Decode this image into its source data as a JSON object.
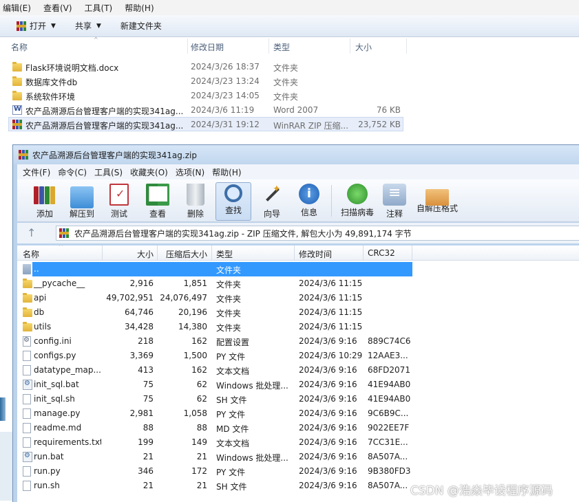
{
  "explorer": {
    "menu": [
      "编辑(E)",
      "查看(V)",
      "工具(T)",
      "帮助(H)"
    ],
    "toolbar": {
      "open_label": "打开",
      "share_label": "共享",
      "new_folder_label": "新建文件夹"
    },
    "columns": {
      "name": "名称",
      "date": "修改日期",
      "type": "类型",
      "size": "大小"
    },
    "rows": [
      {
        "icon": "folder-icon",
        "name": "Flask环境说明文档.docx",
        "date": "2024/3/26 18:37",
        "type": "文件夹",
        "size": ""
      },
      {
        "icon": "folder-icon",
        "name": "数据库文件db",
        "date": "2024/3/23 13:24",
        "type": "文件夹",
        "size": ""
      },
      {
        "icon": "folder-icon",
        "name": "系统软件环境",
        "date": "2024/3/23 14:05",
        "type": "文件夹",
        "size": ""
      },
      {
        "icon": "word-icon",
        "name": "农产品溯源后台管理客户端的实现341ag...",
        "date": "2024/3/6 11:19",
        "type": "Word 2007",
        "size": "76 KB"
      },
      {
        "icon": "winrar-icon",
        "name": "农产品溯源后台管理客户端的实现341ag...",
        "date": "2024/3/31 19:12",
        "type": "WinRAR ZIP 压缩...",
        "size": "23,752 KB"
      }
    ]
  },
  "winrar": {
    "title": "农产品溯源后台管理客户端的实现341ag.zip",
    "menu": [
      "文件(F)",
      "命令(C)",
      "工具(S)",
      "收藏夹(O)",
      "选项(N)",
      "帮助(H)"
    ],
    "tools": [
      {
        "label": "添加",
        "icon": "add-archive-icon"
      },
      {
        "label": "解压到",
        "icon": "extract-to-icon"
      },
      {
        "label": "测试",
        "icon": "test-icon"
      },
      {
        "label": "查看",
        "icon": "view-icon"
      },
      {
        "label": "删除",
        "icon": "delete-icon"
      },
      {
        "label": "查找",
        "icon": "find-icon"
      },
      {
        "label": "向导",
        "icon": "wizard-icon"
      },
      {
        "label": "信息",
        "icon": "info-icon"
      },
      {
        "label": "扫描病毒",
        "icon": "virus-scan-icon"
      },
      {
        "label": "注释",
        "icon": "comment-icon"
      },
      {
        "label": "自解压格式",
        "icon": "sfx-icon"
      }
    ],
    "address": "农产品溯源后台管理客户端的实现341ag.zip - ZIP 压缩文件, 解包大小为 49,891,174 字节",
    "columns": {
      "name": "名称",
      "size": "大小",
      "packed": "压缩后大小",
      "type": "类型",
      "modified": "修改时间",
      "crc": "CRC32"
    },
    "files": [
      {
        "icon": "parent-folder-icon",
        "name": "..",
        "size": "",
        "packed": "",
        "type": "文件夹",
        "modified": "",
        "crc": ""
      },
      {
        "icon": "folder-icon",
        "name": "__pycache__",
        "size": "2,916",
        "packed": "1,851",
        "type": "文件夹",
        "modified": "2024/3/6 11:15",
        "crc": ""
      },
      {
        "icon": "folder-icon",
        "name": "api",
        "size": "49,702,951",
        "packed": "24,076,497",
        "type": "文件夹",
        "modified": "2024/3/6 11:15",
        "crc": ""
      },
      {
        "icon": "folder-icon",
        "name": "db",
        "size": "64,746",
        "packed": "20,196",
        "type": "文件夹",
        "modified": "2024/3/6 11:15",
        "crc": ""
      },
      {
        "icon": "folder-icon",
        "name": "utils",
        "size": "34,428",
        "packed": "14,380",
        "type": "文件夹",
        "modified": "2024/3/6 11:15",
        "crc": ""
      },
      {
        "icon": "settings-file-icon",
        "name": "config.ini",
        "size": "218",
        "packed": "162",
        "type": "配置设置",
        "modified": "2024/3/6 9:16",
        "crc": "889C74C6"
      },
      {
        "icon": "file-icon",
        "name": "configs.py",
        "size": "3,369",
        "packed": "1,500",
        "type": "PY 文件",
        "modified": "2024/3/6 10:29",
        "crc": "12AAE3..."
      },
      {
        "icon": "file-icon",
        "name": "datatype_map....",
        "size": "413",
        "packed": "162",
        "type": "文本文档",
        "modified": "2024/3/6 9:16",
        "crc": "68FD2071"
      },
      {
        "icon": "batch-file-icon",
        "name": "init_sql.bat",
        "size": "75",
        "packed": "62",
        "type": "Windows 批处理...",
        "modified": "2024/3/6 9:16",
        "crc": "41E94AB0"
      },
      {
        "icon": "file-icon",
        "name": "init_sql.sh",
        "size": "75",
        "packed": "62",
        "type": "SH 文件",
        "modified": "2024/3/6 9:16",
        "crc": "41E94AB0"
      },
      {
        "icon": "file-icon",
        "name": "manage.py",
        "size": "2,981",
        "packed": "1,058",
        "type": "PY 文件",
        "modified": "2024/3/6 9:16",
        "crc": "9C6B9C..."
      },
      {
        "icon": "file-icon",
        "name": "readme.md",
        "size": "88",
        "packed": "88",
        "type": "MD 文件",
        "modified": "2024/3/6 9:16",
        "crc": "9022EE7F"
      },
      {
        "icon": "file-icon",
        "name": "requirements.txt",
        "size": "199",
        "packed": "149",
        "type": "文本文档",
        "modified": "2024/3/6 9:16",
        "crc": "7CC31E..."
      },
      {
        "icon": "batch-file-icon",
        "name": "run.bat",
        "size": "21",
        "packed": "21",
        "type": "Windows 批处理...",
        "modified": "2024/3/6 9:16",
        "crc": "8A507A..."
      },
      {
        "icon": "file-icon",
        "name": "run.py",
        "size": "346",
        "packed": "172",
        "type": "PY 文件",
        "modified": "2024/3/6 9:16",
        "crc": "9B380FD3"
      },
      {
        "icon": "file-icon",
        "name": "run.sh",
        "size": "21",
        "packed": "21",
        "type": "SH 文件",
        "modified": "2024/3/6 9:16",
        "crc": "8A507A..."
      }
    ]
  },
  "watermark": "CSDN @浩焱毕设程序源码"
}
